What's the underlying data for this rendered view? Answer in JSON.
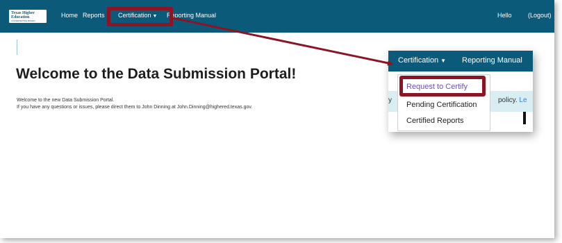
{
  "brand": {
    "logo_line1": "Texas Higher",
    "logo_line2": "Education",
    "logo_line3": "COORDINATING BOARD"
  },
  "nav": {
    "home": "Home",
    "reports": "Reports",
    "certification": "Certification",
    "reporting_manual": "Reporting Manual",
    "hello": "Hello",
    "logout": "(Logout)"
  },
  "main": {
    "title": "Welcome to the Data Submission Portal!",
    "intro_line1": "Welcome to the new Data Submission Portal.",
    "intro_line2": "If you have any questions or issues, please direct them to John Dinning at John.Dinning@highered.texas.gov."
  },
  "inset": {
    "certification": "Certification",
    "reporting_manual": "Reporting Manual",
    "alert_left": "y",
    "alert_right": "policy.",
    "alert_link": "Le",
    "dropdown_items": [
      "Request to Certify",
      "Pending Certification",
      "Certified Reports"
    ]
  },
  "colors": {
    "navbar": "#0b5a7a",
    "highlight": "#8b1426",
    "dropdown_active": "#6a4fb3"
  }
}
